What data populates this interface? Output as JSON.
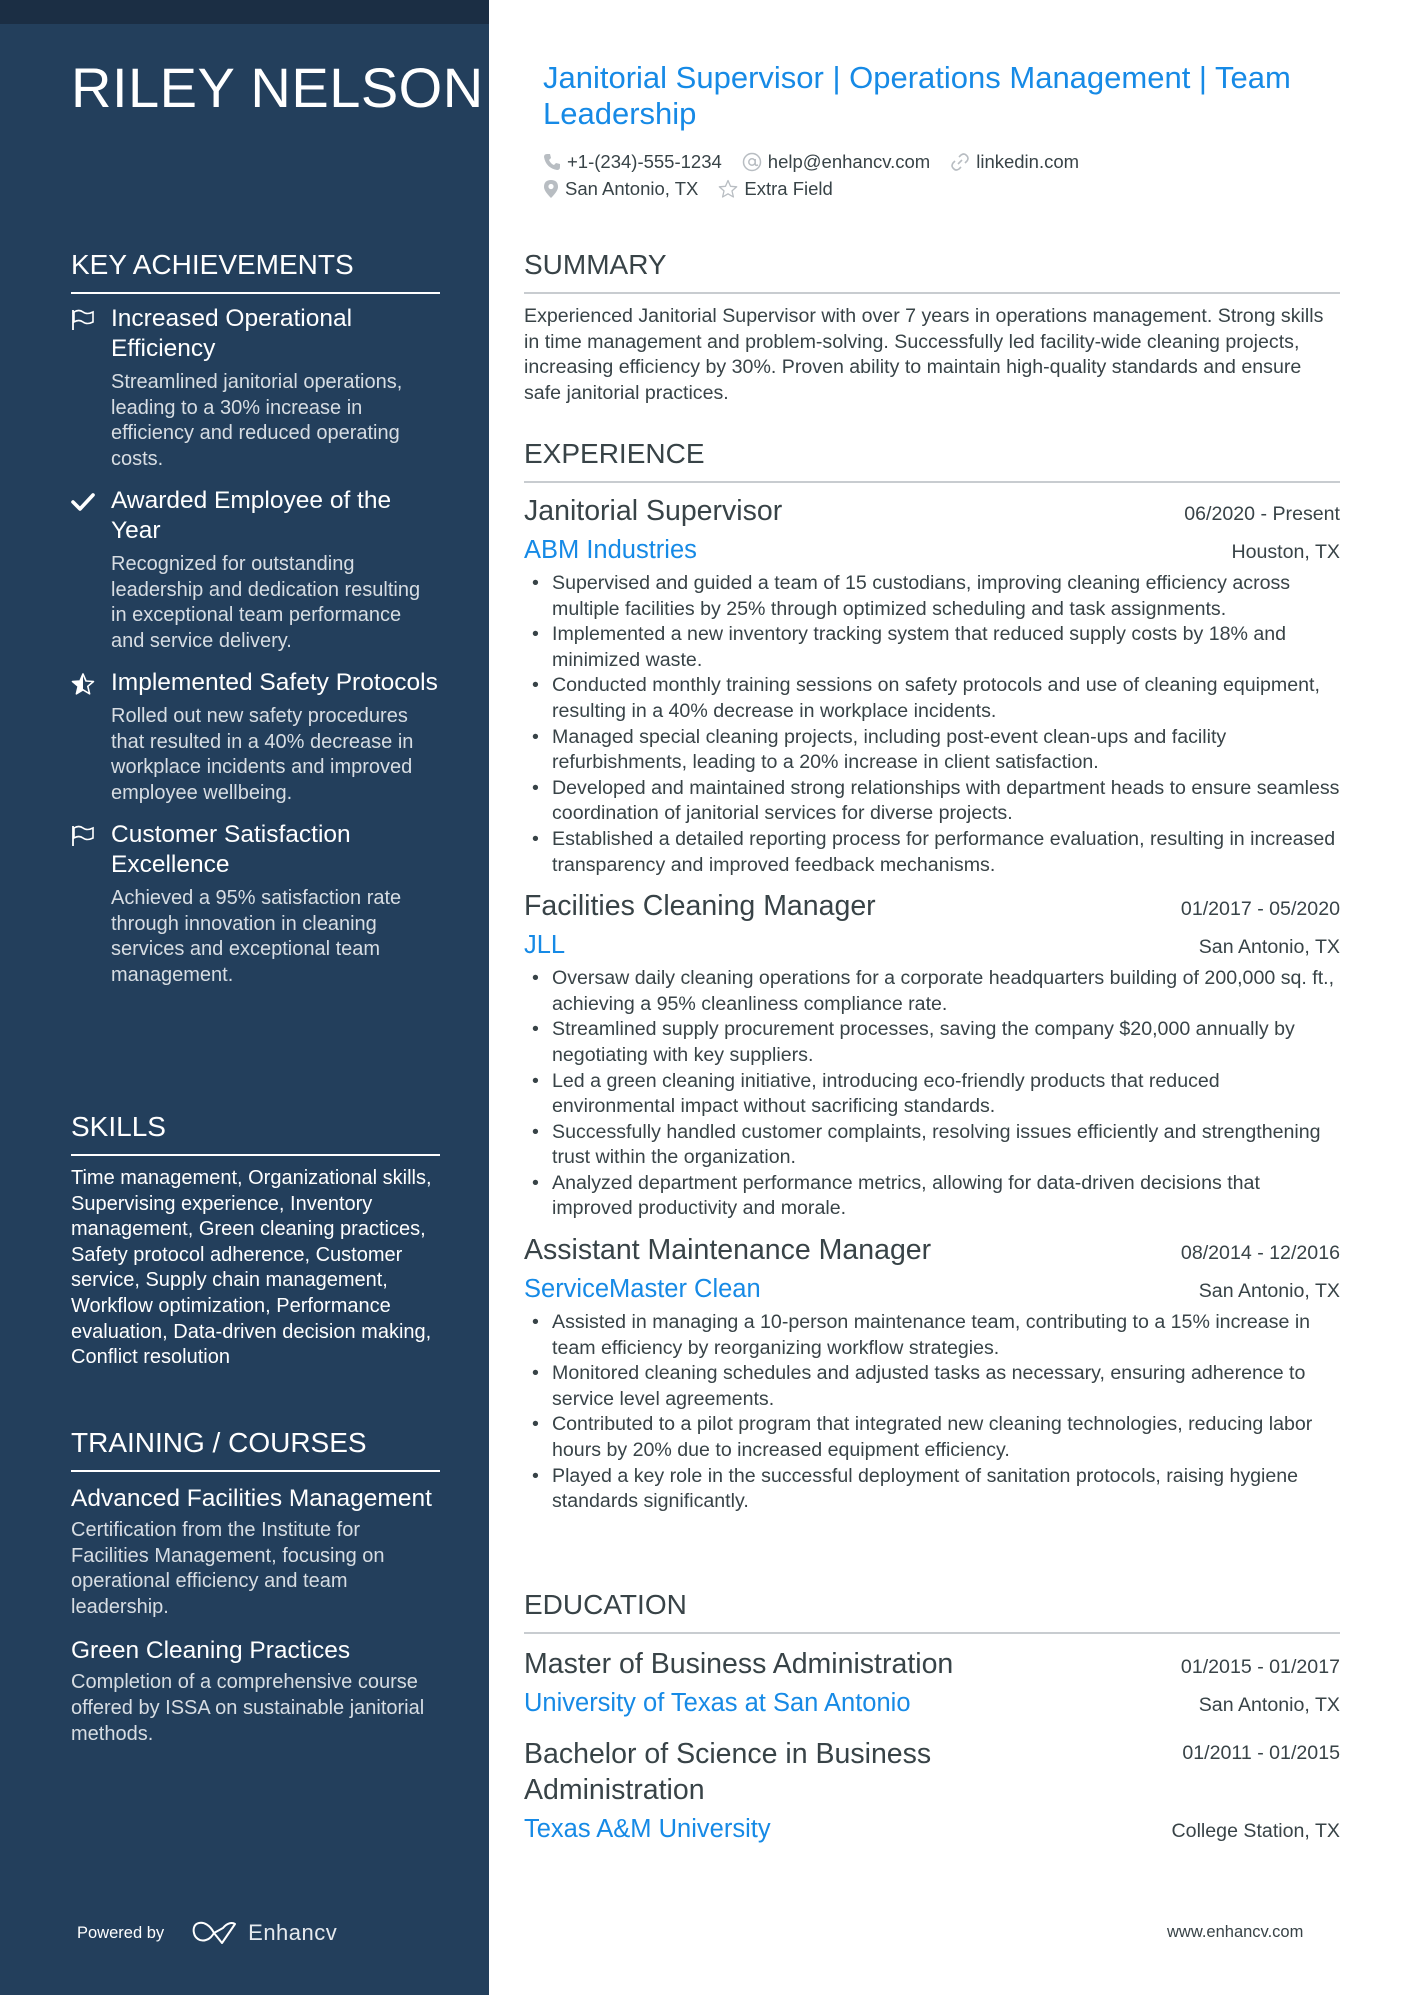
{
  "name": "RILEY NELSON",
  "headline": "Janitorial Supervisor | Operations Management | Team Leadership",
  "contacts": {
    "phone": "+1-(234)-555-1234",
    "email": "help@enhancv.com",
    "link": "linkedin.com",
    "location": "San Antonio, TX",
    "extra": "Extra Field"
  },
  "sidebar": {
    "achievements": {
      "title": "KEY ACHIEVEMENTS",
      "items": [
        {
          "icon": "flag-icon",
          "title": "Increased Operational Efficiency",
          "desc": "Streamlined janitorial operations, leading to a 30% increase in efficiency and reduced operating costs."
        },
        {
          "icon": "check-icon",
          "title": "Awarded Employee of the Year",
          "desc": "Recognized for outstanding leadership and dedication resulting in exceptional team performance and service delivery."
        },
        {
          "icon": "star-half-icon",
          "title": "Implemented Safety Protocols",
          "desc": "Rolled out new safety procedures that resulted in a 40% decrease in workplace incidents and improved employee wellbeing."
        },
        {
          "icon": "flag-icon",
          "title": "Customer Satisfaction Excellence",
          "desc": "Achieved a 95% satisfaction rate through innovation in cleaning services and exceptional team management."
        }
      ]
    },
    "skills": {
      "title": "SKILLS",
      "text": "Time management, Organizational skills, Supervising experience, Inventory management, Green cleaning practices, Safety protocol adherence, Customer service, Supply chain management, Workflow optimization, Performance evaluation, Data-driven decision making, Conflict resolution"
    },
    "training": {
      "title": "TRAINING / COURSES",
      "items": [
        {
          "title": "Advanced Facilities Management",
          "desc": "Certification from the Institute for Facilities Management, focusing on operational efficiency and team leadership."
        },
        {
          "title": "Green Cleaning Practices",
          "desc": "Completion of a comprehensive course offered by ISSA on sustainable janitorial methods."
        }
      ]
    },
    "powered_by": "Powered by",
    "brand": "Enhancv"
  },
  "summary": {
    "title": "SUMMARY",
    "text": "Experienced Janitorial Supervisor with over 7 years in operations management. Strong skills in time management and problem-solving. Successfully led facility-wide cleaning projects, increasing efficiency by 30%. Proven ability to maintain high-quality standards and ensure safe janitorial practices."
  },
  "experience": {
    "title": "EXPERIENCE",
    "jobs": [
      {
        "title": "Janitorial Supervisor",
        "dates": "06/2020 - Present",
        "company": "ABM Industries",
        "location": "Houston, TX",
        "bullets": [
          "Supervised and guided a team of 15 custodians, improving cleaning efficiency across multiple facilities by 25% through optimized scheduling and task assignments.",
          "Implemented a new inventory tracking system that reduced supply costs by 18% and minimized waste.",
          "Conducted monthly training sessions on safety protocols and use of cleaning equipment, resulting in a 40% decrease in workplace incidents.",
          "Managed special cleaning projects, including post-event clean-ups and facility refurbishments, leading to a 20% increase in client satisfaction.",
          "Developed and maintained strong relationships with department heads to ensure seamless coordination of janitorial services for diverse projects.",
          "Established a detailed reporting process for performance evaluation, resulting in increased transparency and improved feedback mechanisms."
        ]
      },
      {
        "title": "Facilities Cleaning Manager",
        "dates": "01/2017 - 05/2020",
        "company": "JLL",
        "location": "San Antonio, TX",
        "bullets": [
          "Oversaw daily cleaning operations for a corporate headquarters building of 200,000 sq. ft., achieving a 95% cleanliness compliance rate.",
          "Streamlined supply procurement processes, saving the company $20,000 annually by negotiating with key suppliers.",
          "Led a green cleaning initiative, introducing eco-friendly products that reduced environmental impact without sacrificing standards.",
          "Successfully handled customer complaints, resolving issues efficiently and strengthening trust within the organization.",
          "Analyzed department performance metrics, allowing for data-driven decisions that improved productivity and morale."
        ]
      },
      {
        "title": "Assistant Maintenance Manager",
        "dates": "08/2014 - 12/2016",
        "company": "ServiceMaster Clean",
        "location": "San Antonio, TX",
        "bullets": [
          "Assisted in managing a 10-person maintenance team, contributing to a 15% increase in team efficiency by reorganizing workflow strategies.",
          "Monitored cleaning schedules and adjusted tasks as necessary, ensuring adherence to service level agreements.",
          "Contributed to a pilot program that integrated new cleaning technologies, reducing labor hours by 20% due to increased equipment efficiency.",
          "Played a key role in the successful deployment of sanitation protocols, raising hygiene standards significantly."
        ]
      }
    ]
  },
  "education": {
    "title": "EDUCATION",
    "items": [
      {
        "degree": "Master of Business Administration",
        "dates": "01/2015 - 01/2017",
        "school": "University of Texas at San Antonio",
        "location": "San Antonio, TX"
      },
      {
        "degree": "Bachelor of Science in Business Administration",
        "dates": "01/2011 - 01/2015",
        "school": "Texas A&M University",
        "location": "College Station, TX"
      }
    ]
  },
  "footer": {
    "site": "www.enhancv.com"
  },
  "colors": {
    "sidebar_bg": "#233f5c",
    "accent": "#168ae6",
    "text": "#384347"
  }
}
